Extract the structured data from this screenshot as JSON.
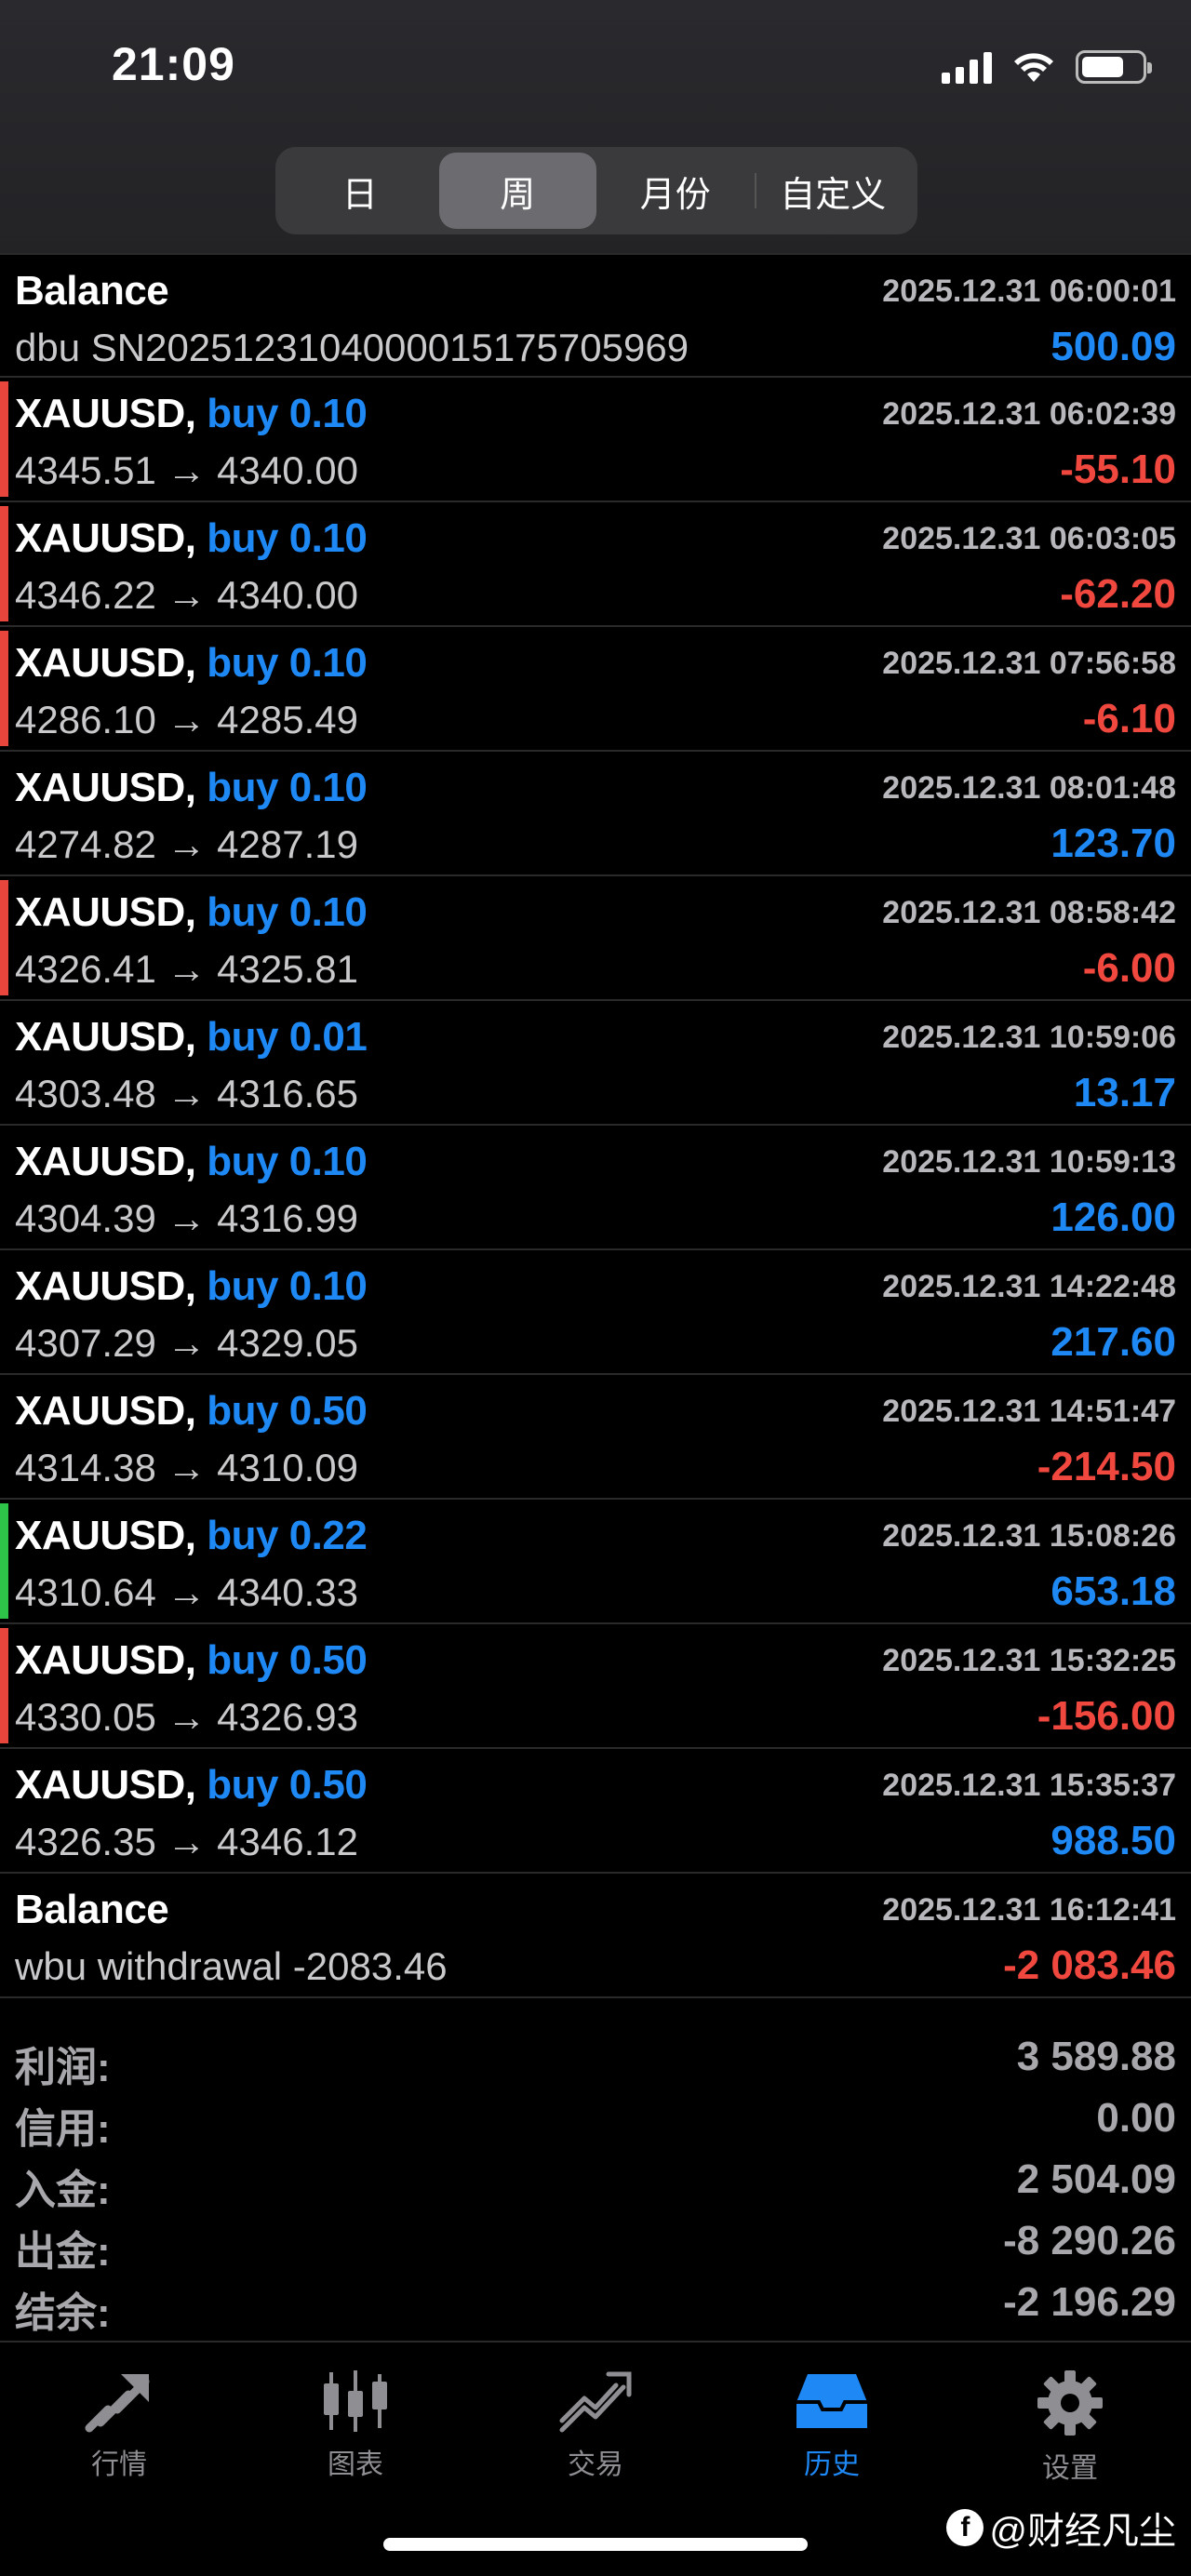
{
  "status_bar": {
    "time": "21:09"
  },
  "period_tabs": [
    {
      "label": "日",
      "active": false
    },
    {
      "label": "周",
      "active": true
    },
    {
      "label": "月份",
      "active": false
    },
    {
      "label": "自定义",
      "active": false
    }
  ],
  "colors": {
    "accent": "#1e88f5",
    "loss": "#f0483e",
    "gain_marker": "#2ec44a"
  },
  "history": [
    {
      "type": "balance",
      "title": "Balance",
      "time": "2025.12.31 06:00:01",
      "sub": "dbu SN2025123104000015175705969",
      "profit": "500.09",
      "sign": "pos",
      "marker": "none"
    },
    {
      "type": "trade",
      "symbol": "XAUUSD,",
      "side": "buy 0.10",
      "time": "2025.12.31 06:02:39",
      "sub": "4345.51 → 4340.00",
      "profit": "-55.10",
      "sign": "neg",
      "marker": "red"
    },
    {
      "type": "trade",
      "symbol": "XAUUSD,",
      "side": "buy 0.10",
      "time": "2025.12.31 06:03:05",
      "sub": "4346.22 → 4340.00",
      "profit": "-62.20",
      "sign": "neg",
      "marker": "red"
    },
    {
      "type": "trade",
      "symbol": "XAUUSD,",
      "side": "buy 0.10",
      "time": "2025.12.31 07:56:58",
      "sub": "4286.10 → 4285.49",
      "profit": "-6.10",
      "sign": "neg",
      "marker": "red"
    },
    {
      "type": "trade",
      "symbol": "XAUUSD,",
      "side": "buy 0.10",
      "time": "2025.12.31 08:01:48",
      "sub": "4274.82 → 4287.19",
      "profit": "123.70",
      "sign": "pos",
      "marker": "none"
    },
    {
      "type": "trade",
      "symbol": "XAUUSD,",
      "side": "buy 0.10",
      "time": "2025.12.31 08:58:42",
      "sub": "4326.41 → 4325.81",
      "profit": "-6.00",
      "sign": "neg",
      "marker": "red"
    },
    {
      "type": "trade",
      "symbol": "XAUUSD,",
      "side": "buy 0.01",
      "time": "2025.12.31 10:59:06",
      "sub": "4303.48 → 4316.65",
      "profit": "13.17",
      "sign": "pos",
      "marker": "none"
    },
    {
      "type": "trade",
      "symbol": "XAUUSD,",
      "side": "buy 0.10",
      "time": "2025.12.31 10:59:13",
      "sub": "4304.39 → 4316.99",
      "profit": "126.00",
      "sign": "pos",
      "marker": "none"
    },
    {
      "type": "trade",
      "symbol": "XAUUSD,",
      "side": "buy 0.10",
      "time": "2025.12.31 14:22:48",
      "sub": "4307.29 → 4329.05",
      "profit": "217.60",
      "sign": "pos",
      "marker": "none"
    },
    {
      "type": "trade",
      "symbol": "XAUUSD,",
      "side": "buy 0.50",
      "time": "2025.12.31 14:51:47",
      "sub": "4314.38 → 4310.09",
      "profit": "-214.50",
      "sign": "neg",
      "marker": "none"
    },
    {
      "type": "trade",
      "symbol": "XAUUSD,",
      "side": "buy 0.22",
      "time": "2025.12.31 15:08:26",
      "sub": "4310.64 → 4340.33",
      "profit": "653.18",
      "sign": "pos",
      "marker": "green"
    },
    {
      "type": "trade",
      "symbol": "XAUUSD,",
      "side": "buy 0.50",
      "time": "2025.12.31 15:32:25",
      "sub": "4330.05 → 4326.93",
      "profit": "-156.00",
      "sign": "neg",
      "marker": "red"
    },
    {
      "type": "trade",
      "symbol": "XAUUSD,",
      "side": "buy 0.50",
      "time": "2025.12.31 15:35:37",
      "sub": "4326.35 → 4346.12",
      "profit": "988.50",
      "sign": "pos",
      "marker": "none"
    },
    {
      "type": "balance",
      "title": "Balance",
      "time": "2025.12.31 16:12:41",
      "sub": "wbu withdrawal -2083.46",
      "profit": "-2 083.46",
      "sign": "neg",
      "marker": "none"
    }
  ],
  "summary": [
    {
      "label": "利润:",
      "value": "3 589.88"
    },
    {
      "label": "信用:",
      "value": "0.00"
    },
    {
      "label": "入金:",
      "value": "2 504.09"
    },
    {
      "label": "出金:",
      "value": "-8 290.26"
    },
    {
      "label": "结余:",
      "value": "-2 196.29"
    }
  ],
  "tabbar": [
    {
      "label": "行情",
      "icon": "quotes-icon",
      "active": false
    },
    {
      "label": "图表",
      "icon": "chart-icon",
      "active": false
    },
    {
      "label": "交易",
      "icon": "trade-icon",
      "active": false
    },
    {
      "label": "历史",
      "icon": "history-icon",
      "active": true
    },
    {
      "label": "设置",
      "icon": "settings-icon",
      "active": false
    }
  ],
  "watermark": {
    "badge": "f",
    "text": "@财经凡尘"
  }
}
